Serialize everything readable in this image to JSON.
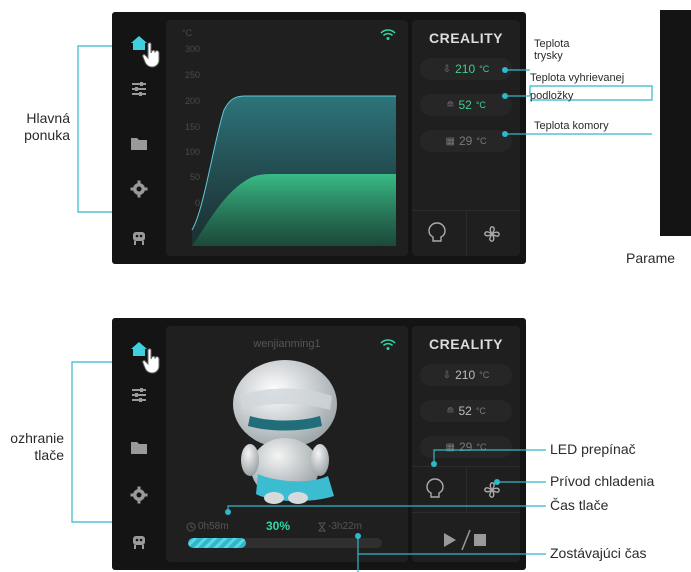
{
  "top_screen": {
    "brand": "CREALITY",
    "unit_label": "°C",
    "y_ticks": [
      "300",
      "250",
      "200",
      "150",
      "100",
      "50",
      "0"
    ],
    "nozzle": {
      "value": "210",
      "unit": "°C"
    },
    "bed": {
      "value": "52",
      "unit": "°C"
    },
    "chamber": {
      "value": "29",
      "unit": "°C"
    }
  },
  "bottom_screen": {
    "brand": "CREALITY",
    "filename": "wenjianming1",
    "nozzle": {
      "value": "210",
      "unit": "°C"
    },
    "bed": {
      "value": "52",
      "unit": "°C"
    },
    "chamber": {
      "value": "29",
      "unit": "°C"
    },
    "elapsed": "0h58m",
    "percent": "30%",
    "remaining": "3h22m",
    "progress_fraction": 0.3
  },
  "callouts": {
    "main_menu_line1": "Hlavná",
    "main_menu_line2": "ponuka",
    "nozzle_temp_line1": "Teplota",
    "nozzle_temp_line2": "trysky",
    "bed_temp_line1": "Teplota vyhrievanej",
    "bed_temp_line2": "podložky",
    "chamber_temp": "Teplota komory",
    "params": "Parame",
    "print_iface_line1": "ozhranie",
    "print_iface_line2": "tlače",
    "led_switch": "LED prepínač",
    "cooling": "Prívod chladenia",
    "print_time": "Čas tlače",
    "remaining_time": "Zostávajúci čas"
  },
  "colors": {
    "accent": "#22b3c5",
    "green": "#3ccf8e",
    "screen_bg": "#141414",
    "panel_bg": "#1f1f1f"
  }
}
